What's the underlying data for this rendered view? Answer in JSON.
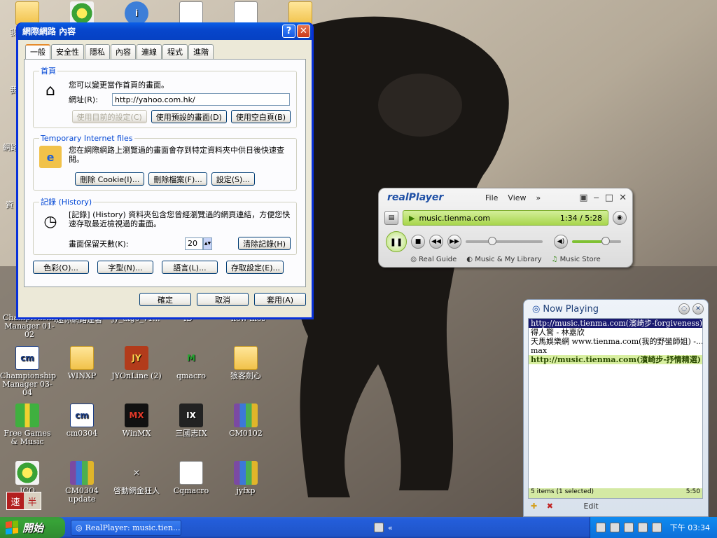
{
  "desktop": {
    "top_icons_labels": [
      "",
      "",
      "",
      "",
      "",
      ""
    ],
    "partial_labels": [
      "我",
      "我",
      "網路",
      "資",
      "Championship Manager 01-02",
      "迷你網路連著",
      "jy_txgo_v1...",
      "ID",
      "new mes"
    ],
    "icons": [
      {
        "label": "Championship Manager 03-04",
        "icon": "cm-icon"
      },
      {
        "label": "WINXP",
        "icon": "folder-icon"
      },
      {
        "label": "JYOnLine (2)",
        "icon": "game-icon"
      },
      {
        "label": "qmacro",
        "icon": "m-icon"
      },
      {
        "label": "狼客劍心",
        "icon": "folder-icon"
      },
      {
        "label": "Free Games & Music",
        "icon": "gift-icon"
      },
      {
        "label": "cm0304",
        "icon": "cm-icon"
      },
      {
        "label": "WinMX",
        "icon": "winmx-icon"
      },
      {
        "label": "三國志IX",
        "icon": "sangokushi-icon"
      },
      {
        "label": "CM0102",
        "icon": "rar-icon"
      },
      {
        "label": "ICQ",
        "icon": "icq-icon"
      },
      {
        "label": "CM0304 update",
        "icon": "rar-icon"
      },
      {
        "label": "啓動網金狂人",
        "icon": "sword-icon"
      },
      {
        "label": "Cqmacro",
        "icon": "doc-icon"
      },
      {
        "label": "jyfxp",
        "icon": "rar-icon"
      }
    ],
    "ime": {
      "a": "速",
      "b": "半"
    }
  },
  "ie_dialog": {
    "title": "網際網路 內容",
    "help": "?",
    "close": "✕",
    "tabs": [
      "一般",
      "安全性",
      "隱私",
      "內容",
      "連線",
      "程式",
      "進階"
    ],
    "home": {
      "legend": "首頁",
      "desc": "您可以變更當作首頁的畫面。",
      "address_label": "網址(R):",
      "address_value": "http://yahoo.com.hk/",
      "btn_current": "使用目前的設定(C)",
      "btn_default": "使用預設的畫面(D)",
      "btn_blank": "使用空白頁(B)"
    },
    "temp": {
      "legend": "Temporary Internet files",
      "desc": "您在網際網路上瀏覽過的畫面會存到特定資料夾中供日後快速查閱。",
      "btn_cookie": "刪除 Cookie(I)...",
      "btn_files": "刪除檔案(F)...",
      "btn_settings": "設定(S)..."
    },
    "history": {
      "legend": "記錄 (History)",
      "desc": "[記錄] (History) 資料夾包含您曾經瀏覽過的網頁連結，方便您快速存取最近檢視過的畫面。",
      "days_label": "畫面保留天數(K):",
      "days_value": "20",
      "btn_clear": "清除記錄(H)"
    },
    "bottom_buttons": [
      "色彩(O)...",
      "字型(N)...",
      "語言(L)...",
      "存取設定(E)..."
    ],
    "ok": "確定",
    "cancel": "取消",
    "apply": "套用(A)"
  },
  "realplayer": {
    "logo": "realPlayer",
    "menu_file": "File",
    "menu_view": "View",
    "menu_more": "»",
    "clip": "music.tienma.com",
    "time": "1:34 / 5:28",
    "progress_fraction": 0.29,
    "volume_fraction": 0.6,
    "link_guide": "Real Guide",
    "link_library": "Music & My Library",
    "link_store": "Music Store"
  },
  "now_playing": {
    "title": "Now Playing",
    "items": [
      "http://music.tienma.com(濱崎步-forgiveness)",
      "得人驚 - 林嘉欣",
      "天馬娛樂網 www.tienma.com(我的野蠻師姐) -...",
      "max",
      "http://music.tienma.com(濱崎步-抒情精選)"
    ],
    "status_left": "5 items (1 selected)",
    "status_right": "5:50",
    "edit": "Edit"
  },
  "taskbar": {
    "start": "開始",
    "task": "RealPlayer: music.tien...",
    "clock": "下午 03:34"
  },
  "colors": {
    "accent": "#0831d9",
    "rp_green": "#a8d64c"
  }
}
